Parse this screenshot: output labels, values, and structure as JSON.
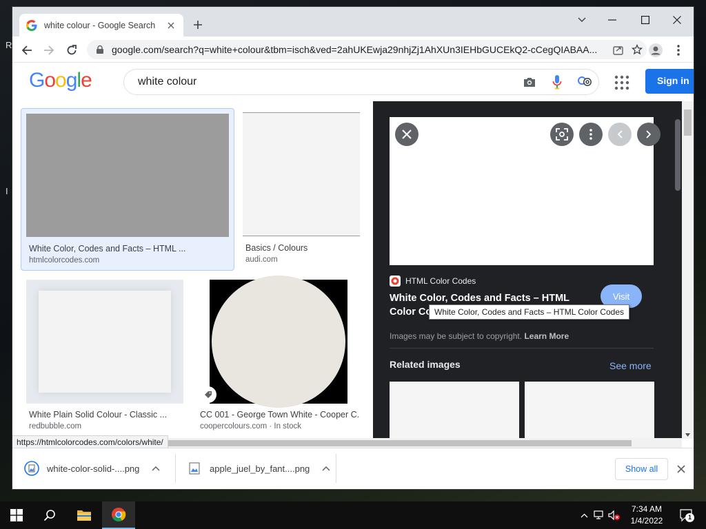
{
  "desktop": {
    "edge_letters": [
      "R",
      "I"
    ]
  },
  "browser": {
    "tab": {
      "title": "white colour - Google Search",
      "favicon": "google-g-icon"
    },
    "window_controls": [
      "chevron-down-icon",
      "minimize-icon",
      "maximize-icon",
      "close-icon"
    ],
    "address": "google.com/search?q=white+colour&tbm=isch&ved=2ahUKEwja29nhjZj1AhXUn3IEHbGUCEkQ2-cCegQIABAA...",
    "status_url": "https://htmlcolorcodes.com/colors/white/"
  },
  "google": {
    "logo": [
      "G",
      "o",
      "o",
      "g",
      "l",
      "e"
    ],
    "logo_colors": [
      "#4285f4",
      "#ea4335",
      "#fbbc05",
      "#4285f4",
      "#34a853",
      "#ea4335"
    ],
    "query": "white colour",
    "sign_in": "Sign in"
  },
  "results": [
    {
      "title": "White Color, Codes and Facts – HTML ...",
      "source": "htmlcolorcodes.com",
      "thumb_color": "#9c9c9c",
      "selected": true
    },
    {
      "title": "Basics / Colours",
      "source": "audi.com",
      "thumb_color": "#f4f4f4"
    },
    {
      "title": "White Plain Solid Colour - Classic ...",
      "source": "redbubble.com",
      "thumb_color": "#e6e9ee"
    },
    {
      "title": "CC 001 - George Town White - Cooper C...",
      "source": "coopercolours.com · In stock",
      "thumb_color": "#e8e6df"
    }
  ],
  "preview": {
    "source_name": "HTML Color Codes",
    "title": "White Color, Codes and Facts – HTML Color Codes",
    "visit": "Visit",
    "tooltip": "White Color, Codes and Facts – HTML Color Codes",
    "copyright_text": "Images may be subject to copyright.",
    "learn_more": "Learn More",
    "related_title": "Related images",
    "see_more": "See more"
  },
  "downloads": {
    "items": [
      {
        "name": "white-color-solid-....png"
      },
      {
        "name": "apple_juel_by_fant....png"
      }
    ],
    "show_all": "Show all"
  },
  "taskbar": {
    "time": "7:34 AM",
    "date": "1/4/2022",
    "notification_count": "1"
  }
}
